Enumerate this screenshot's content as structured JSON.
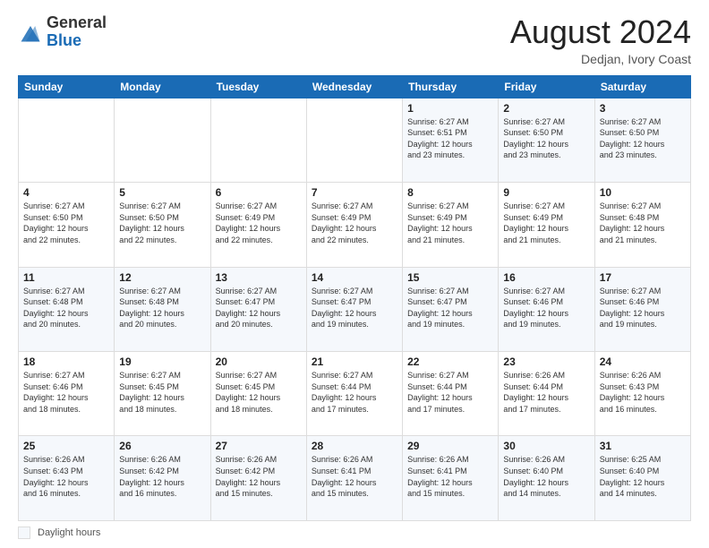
{
  "header": {
    "logo_general": "General",
    "logo_blue": "Blue",
    "month_title": "August 2024",
    "subtitle": "Dedjan, Ivory Coast"
  },
  "calendar": {
    "days_of_week": [
      "Sunday",
      "Monday",
      "Tuesday",
      "Wednesday",
      "Thursday",
      "Friday",
      "Saturday"
    ],
    "weeks": [
      [
        {
          "day": "",
          "info": ""
        },
        {
          "day": "",
          "info": ""
        },
        {
          "day": "",
          "info": ""
        },
        {
          "day": "",
          "info": ""
        },
        {
          "day": "1",
          "info": "Sunrise: 6:27 AM\nSunset: 6:51 PM\nDaylight: 12 hours\nand 23 minutes."
        },
        {
          "day": "2",
          "info": "Sunrise: 6:27 AM\nSunset: 6:50 PM\nDaylight: 12 hours\nand 23 minutes."
        },
        {
          "day": "3",
          "info": "Sunrise: 6:27 AM\nSunset: 6:50 PM\nDaylight: 12 hours\nand 23 minutes."
        }
      ],
      [
        {
          "day": "4",
          "info": "Sunrise: 6:27 AM\nSunset: 6:50 PM\nDaylight: 12 hours\nand 22 minutes."
        },
        {
          "day": "5",
          "info": "Sunrise: 6:27 AM\nSunset: 6:50 PM\nDaylight: 12 hours\nand 22 minutes."
        },
        {
          "day": "6",
          "info": "Sunrise: 6:27 AM\nSunset: 6:49 PM\nDaylight: 12 hours\nand 22 minutes."
        },
        {
          "day": "7",
          "info": "Sunrise: 6:27 AM\nSunset: 6:49 PM\nDaylight: 12 hours\nand 22 minutes."
        },
        {
          "day": "8",
          "info": "Sunrise: 6:27 AM\nSunset: 6:49 PM\nDaylight: 12 hours\nand 21 minutes."
        },
        {
          "day": "9",
          "info": "Sunrise: 6:27 AM\nSunset: 6:49 PM\nDaylight: 12 hours\nand 21 minutes."
        },
        {
          "day": "10",
          "info": "Sunrise: 6:27 AM\nSunset: 6:48 PM\nDaylight: 12 hours\nand 21 minutes."
        }
      ],
      [
        {
          "day": "11",
          "info": "Sunrise: 6:27 AM\nSunset: 6:48 PM\nDaylight: 12 hours\nand 20 minutes."
        },
        {
          "day": "12",
          "info": "Sunrise: 6:27 AM\nSunset: 6:48 PM\nDaylight: 12 hours\nand 20 minutes."
        },
        {
          "day": "13",
          "info": "Sunrise: 6:27 AM\nSunset: 6:47 PM\nDaylight: 12 hours\nand 20 minutes."
        },
        {
          "day": "14",
          "info": "Sunrise: 6:27 AM\nSunset: 6:47 PM\nDaylight: 12 hours\nand 19 minutes."
        },
        {
          "day": "15",
          "info": "Sunrise: 6:27 AM\nSunset: 6:47 PM\nDaylight: 12 hours\nand 19 minutes."
        },
        {
          "day": "16",
          "info": "Sunrise: 6:27 AM\nSunset: 6:46 PM\nDaylight: 12 hours\nand 19 minutes."
        },
        {
          "day": "17",
          "info": "Sunrise: 6:27 AM\nSunset: 6:46 PM\nDaylight: 12 hours\nand 19 minutes."
        }
      ],
      [
        {
          "day": "18",
          "info": "Sunrise: 6:27 AM\nSunset: 6:46 PM\nDaylight: 12 hours\nand 18 minutes."
        },
        {
          "day": "19",
          "info": "Sunrise: 6:27 AM\nSunset: 6:45 PM\nDaylight: 12 hours\nand 18 minutes."
        },
        {
          "day": "20",
          "info": "Sunrise: 6:27 AM\nSunset: 6:45 PM\nDaylight: 12 hours\nand 18 minutes."
        },
        {
          "day": "21",
          "info": "Sunrise: 6:27 AM\nSunset: 6:44 PM\nDaylight: 12 hours\nand 17 minutes."
        },
        {
          "day": "22",
          "info": "Sunrise: 6:27 AM\nSunset: 6:44 PM\nDaylight: 12 hours\nand 17 minutes."
        },
        {
          "day": "23",
          "info": "Sunrise: 6:26 AM\nSunset: 6:44 PM\nDaylight: 12 hours\nand 17 minutes."
        },
        {
          "day": "24",
          "info": "Sunrise: 6:26 AM\nSunset: 6:43 PM\nDaylight: 12 hours\nand 16 minutes."
        }
      ],
      [
        {
          "day": "25",
          "info": "Sunrise: 6:26 AM\nSunset: 6:43 PM\nDaylight: 12 hours\nand 16 minutes."
        },
        {
          "day": "26",
          "info": "Sunrise: 6:26 AM\nSunset: 6:42 PM\nDaylight: 12 hours\nand 16 minutes."
        },
        {
          "day": "27",
          "info": "Sunrise: 6:26 AM\nSunset: 6:42 PM\nDaylight: 12 hours\nand 15 minutes."
        },
        {
          "day": "28",
          "info": "Sunrise: 6:26 AM\nSunset: 6:41 PM\nDaylight: 12 hours\nand 15 minutes."
        },
        {
          "day": "29",
          "info": "Sunrise: 6:26 AM\nSunset: 6:41 PM\nDaylight: 12 hours\nand 15 minutes."
        },
        {
          "day": "30",
          "info": "Sunrise: 6:26 AM\nSunset: 6:40 PM\nDaylight: 12 hours\nand 14 minutes."
        },
        {
          "day": "31",
          "info": "Sunrise: 6:25 AM\nSunset: 6:40 PM\nDaylight: 12 hours\nand 14 minutes."
        }
      ]
    ]
  },
  "legend": {
    "daylight_hours": "Daylight hours"
  }
}
